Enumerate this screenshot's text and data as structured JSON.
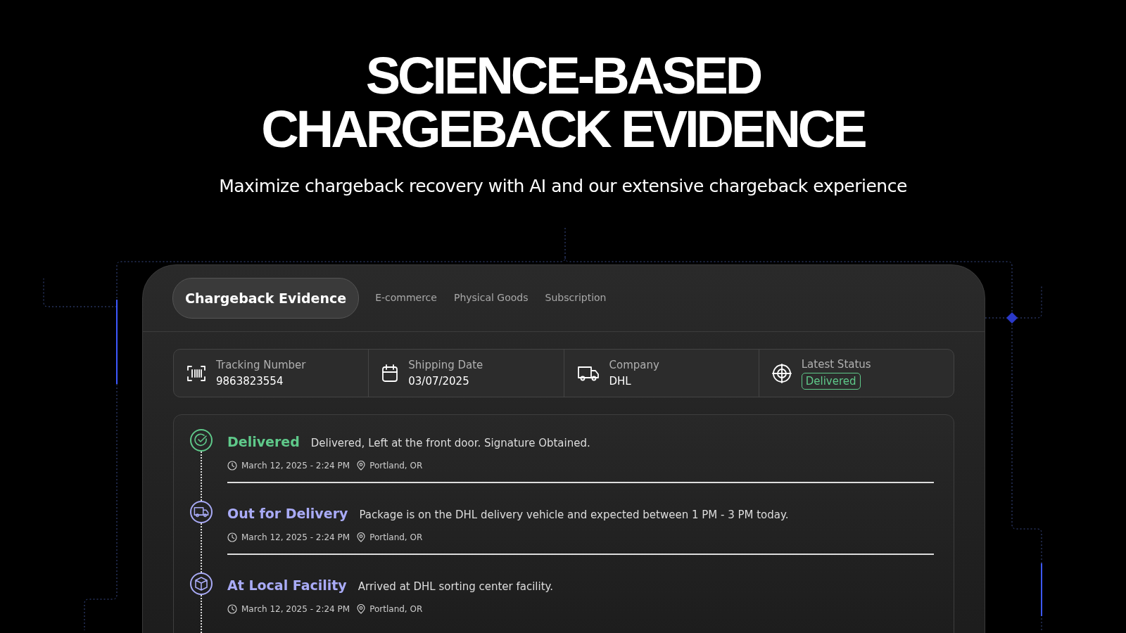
{
  "hero": {
    "title_lines": [
      "SCIENCE-BASED",
      "CHARGEBACK EVIDENCE"
    ],
    "subtitle": "Maximize chargeback recovery with AI and our extensive chargeback experience"
  },
  "tabs": [
    {
      "label": "Chargeback Evidence",
      "selected": true
    },
    {
      "label": "E-commerce",
      "selected": false
    },
    {
      "label": "Physical Goods",
      "selected": false
    },
    {
      "label": "Subscription",
      "selected": false
    }
  ],
  "summary": [
    {
      "kind": "barcode",
      "label": "Tracking Number",
      "value": "9863823554"
    },
    {
      "kind": "calendar",
      "label": "Shipping Date",
      "value": "03/07/2025"
    },
    {
      "kind": "truck",
      "label": "Company",
      "value": "DHL"
    },
    {
      "kind": "status",
      "label": "Latest Status",
      "value": "Delivered",
      "color": "#5fc98a"
    }
  ],
  "timeline": [
    {
      "kind": "check",
      "title": "Delivered",
      "color": "#5fc98a",
      "description": "Delivered, Left at the front door. Signature Obtained.",
      "time": "March 12, 2025 - 2:24 PM",
      "location": "Portland, OR"
    },
    {
      "kind": "truck",
      "title": "Out for Delivery",
      "color": "#a9abf7",
      "description": "Package is on the DHL delivery vehicle and expected between 1 PM - 3 PM today.",
      "time": "March 12, 2025 - 2:24 PM",
      "location": "Portland, OR"
    },
    {
      "kind": "box",
      "title": "At Local Facility",
      "color": "#a9abf7",
      "description": "Arrived at DHL sorting center facility.",
      "time": "March 12, 2025 - 2:24 PM",
      "location": "Portland, OR"
    }
  ]
}
